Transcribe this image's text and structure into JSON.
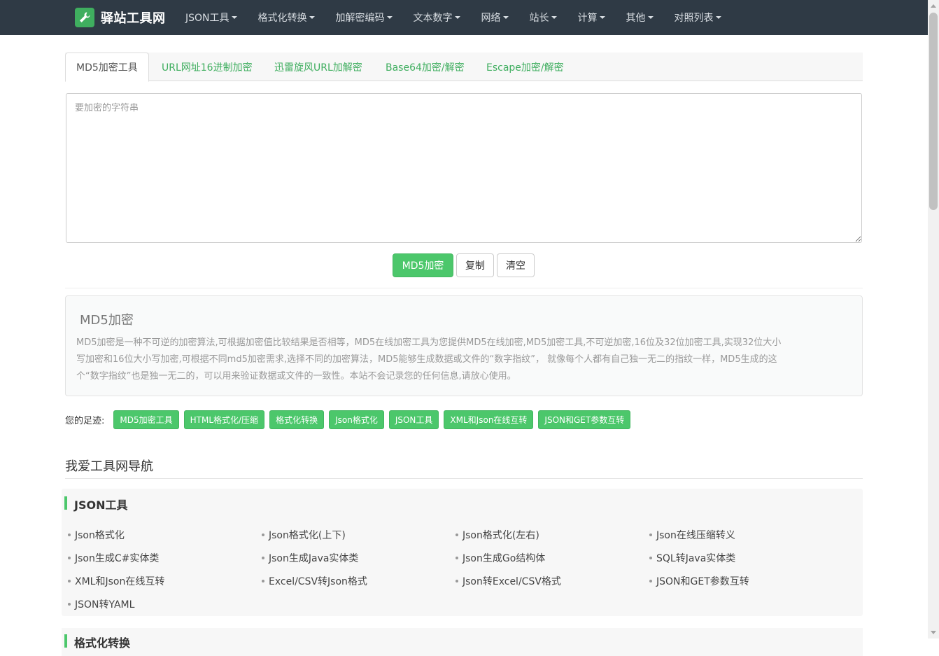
{
  "brand": {
    "name": "驿站工具网",
    "logo_icon": "wrench-icon",
    "accent": "#3fae5f"
  },
  "nav": [
    {
      "label": "JSON工具"
    },
    {
      "label": "格式化转换"
    },
    {
      "label": "加解密编码"
    },
    {
      "label": "文本数字"
    },
    {
      "label": "网络"
    },
    {
      "label": "站长"
    },
    {
      "label": "计算"
    },
    {
      "label": "其他"
    },
    {
      "label": "对照列表"
    }
  ],
  "tabs": [
    {
      "label": "MD5加密工具",
      "active": true
    },
    {
      "label": "URL网址16进制加密"
    },
    {
      "label": "迅雷旋风URL加解密"
    },
    {
      "label": "Base64加密/解密"
    },
    {
      "label": "Escape加密/解密"
    }
  ],
  "input": {
    "placeholder": "要加密的字符串",
    "value": ""
  },
  "buttons": {
    "encrypt": "MD5加密",
    "copy": "复制",
    "clear": "清空"
  },
  "description": {
    "title": "MD5加密",
    "lines": [
      "MD5加密是一种不可逆的加密算法,可根据加密值比较结果是否相等，MD5在线加密工具为您提供MD5在线加密,MD5加密工具,不可逆加密,16位及32位加密工具,实现32位大小",
      "写加密和16位大小写加密,可根据不同md5加密需求,选择不同的加密算法，MD5能够生成数据或文件的“数字指纹”， 就像每个人都有自己独一无二的指纹一样，MD5生成的这",
      "个“数字指纹”也是独一无二的，可以用来验证数据或文件的一致性。本站不会记录您的任何信息,请放心使用。"
    ]
  },
  "footprint": {
    "label": "您的足迹:",
    "tags": [
      "MD5加密工具",
      "HTML格式化/压缩",
      "格式化转换",
      "Json格式化",
      "JSON工具",
      "XML和Json在线互转",
      "JSON和GET参数互转"
    ]
  },
  "nav_section": {
    "heading": "我爱工具网导航"
  },
  "json_tools": {
    "title": "JSON工具",
    "links": [
      "Json格式化",
      "Json格式化(上下)",
      "Json格式化(左右)",
      "Json在线压缩转义",
      "Json生成C#实体类",
      "Json生成Java实体类",
      "Json生成Go结构体",
      "SQL转Java实体类",
      "XML和Json在线互转",
      "Excel/CSV转Json格式",
      "Json转Excel/CSV格式",
      "JSON和GET参数互转",
      "JSON转YAML"
    ]
  },
  "next_section": {
    "title": "格式化转换"
  }
}
